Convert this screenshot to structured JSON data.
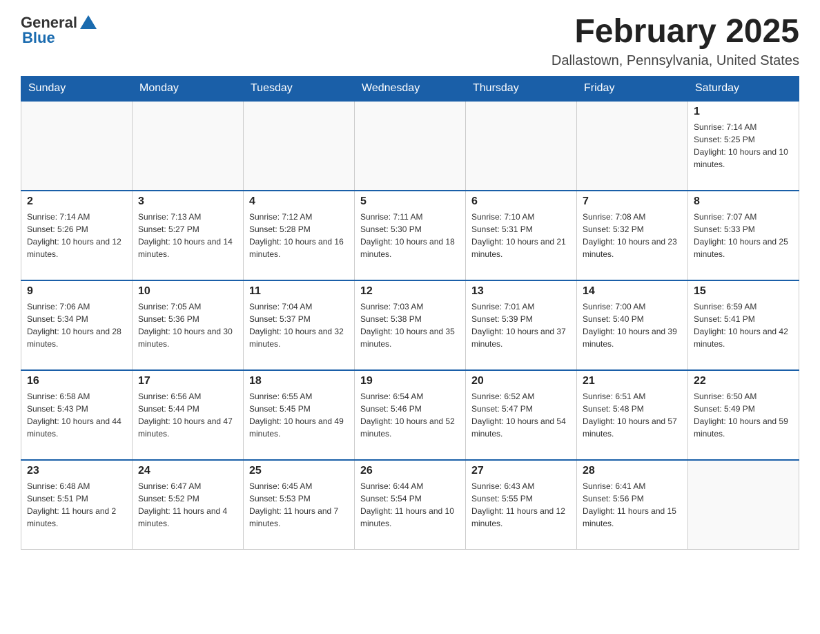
{
  "logo": {
    "general": "General",
    "blue": "Blue"
  },
  "title": {
    "month": "February 2025",
    "location": "Dallastown, Pennsylvania, United States"
  },
  "weekdays": [
    "Sunday",
    "Monday",
    "Tuesday",
    "Wednesday",
    "Thursday",
    "Friday",
    "Saturday"
  ],
  "weeks": [
    [
      {
        "day": "",
        "info": ""
      },
      {
        "day": "",
        "info": ""
      },
      {
        "day": "",
        "info": ""
      },
      {
        "day": "",
        "info": ""
      },
      {
        "day": "",
        "info": ""
      },
      {
        "day": "",
        "info": ""
      },
      {
        "day": "1",
        "info": "Sunrise: 7:14 AM\nSunset: 5:25 PM\nDaylight: 10 hours and 10 minutes."
      }
    ],
    [
      {
        "day": "2",
        "info": "Sunrise: 7:14 AM\nSunset: 5:26 PM\nDaylight: 10 hours and 12 minutes."
      },
      {
        "day": "3",
        "info": "Sunrise: 7:13 AM\nSunset: 5:27 PM\nDaylight: 10 hours and 14 minutes."
      },
      {
        "day": "4",
        "info": "Sunrise: 7:12 AM\nSunset: 5:28 PM\nDaylight: 10 hours and 16 minutes."
      },
      {
        "day": "5",
        "info": "Sunrise: 7:11 AM\nSunset: 5:30 PM\nDaylight: 10 hours and 18 minutes."
      },
      {
        "day": "6",
        "info": "Sunrise: 7:10 AM\nSunset: 5:31 PM\nDaylight: 10 hours and 21 minutes."
      },
      {
        "day": "7",
        "info": "Sunrise: 7:08 AM\nSunset: 5:32 PM\nDaylight: 10 hours and 23 minutes."
      },
      {
        "day": "8",
        "info": "Sunrise: 7:07 AM\nSunset: 5:33 PM\nDaylight: 10 hours and 25 minutes."
      }
    ],
    [
      {
        "day": "9",
        "info": "Sunrise: 7:06 AM\nSunset: 5:34 PM\nDaylight: 10 hours and 28 minutes."
      },
      {
        "day": "10",
        "info": "Sunrise: 7:05 AM\nSunset: 5:36 PM\nDaylight: 10 hours and 30 minutes."
      },
      {
        "day": "11",
        "info": "Sunrise: 7:04 AM\nSunset: 5:37 PM\nDaylight: 10 hours and 32 minutes."
      },
      {
        "day": "12",
        "info": "Sunrise: 7:03 AM\nSunset: 5:38 PM\nDaylight: 10 hours and 35 minutes."
      },
      {
        "day": "13",
        "info": "Sunrise: 7:01 AM\nSunset: 5:39 PM\nDaylight: 10 hours and 37 minutes."
      },
      {
        "day": "14",
        "info": "Sunrise: 7:00 AM\nSunset: 5:40 PM\nDaylight: 10 hours and 39 minutes."
      },
      {
        "day": "15",
        "info": "Sunrise: 6:59 AM\nSunset: 5:41 PM\nDaylight: 10 hours and 42 minutes."
      }
    ],
    [
      {
        "day": "16",
        "info": "Sunrise: 6:58 AM\nSunset: 5:43 PM\nDaylight: 10 hours and 44 minutes."
      },
      {
        "day": "17",
        "info": "Sunrise: 6:56 AM\nSunset: 5:44 PM\nDaylight: 10 hours and 47 minutes."
      },
      {
        "day": "18",
        "info": "Sunrise: 6:55 AM\nSunset: 5:45 PM\nDaylight: 10 hours and 49 minutes."
      },
      {
        "day": "19",
        "info": "Sunrise: 6:54 AM\nSunset: 5:46 PM\nDaylight: 10 hours and 52 minutes."
      },
      {
        "day": "20",
        "info": "Sunrise: 6:52 AM\nSunset: 5:47 PM\nDaylight: 10 hours and 54 minutes."
      },
      {
        "day": "21",
        "info": "Sunrise: 6:51 AM\nSunset: 5:48 PM\nDaylight: 10 hours and 57 minutes."
      },
      {
        "day": "22",
        "info": "Sunrise: 6:50 AM\nSunset: 5:49 PM\nDaylight: 10 hours and 59 minutes."
      }
    ],
    [
      {
        "day": "23",
        "info": "Sunrise: 6:48 AM\nSunset: 5:51 PM\nDaylight: 11 hours and 2 minutes."
      },
      {
        "day": "24",
        "info": "Sunrise: 6:47 AM\nSunset: 5:52 PM\nDaylight: 11 hours and 4 minutes."
      },
      {
        "day": "25",
        "info": "Sunrise: 6:45 AM\nSunset: 5:53 PM\nDaylight: 11 hours and 7 minutes."
      },
      {
        "day": "26",
        "info": "Sunrise: 6:44 AM\nSunset: 5:54 PM\nDaylight: 11 hours and 10 minutes."
      },
      {
        "day": "27",
        "info": "Sunrise: 6:43 AM\nSunset: 5:55 PM\nDaylight: 11 hours and 12 minutes."
      },
      {
        "day": "28",
        "info": "Sunrise: 6:41 AM\nSunset: 5:56 PM\nDaylight: 11 hours and 15 minutes."
      },
      {
        "day": "",
        "info": ""
      }
    ]
  ]
}
